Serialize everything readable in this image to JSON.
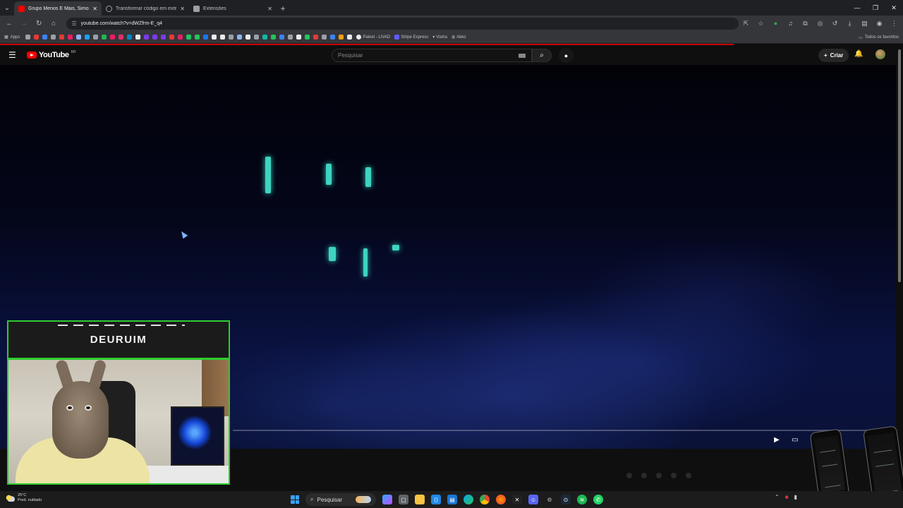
{
  "browser": {
    "tabs": [
      {
        "title": "Grupo Menos É Mais, Simo...",
        "favicon_color": "#ff0000",
        "active": true
      },
      {
        "title": "Transformar código em extensã...",
        "favicon_color": "#9aa0a6",
        "active": false
      },
      {
        "title": "Extensões",
        "favicon_color": "#9aa0a6",
        "active": false
      }
    ],
    "new_tab_symbol": "+",
    "url": "youtube.com/watch?v=dWZfrm-E_q4",
    "bookmarks": {
      "apps_label": "Apps",
      "items": [
        "Painel - LIVAD",
        "Stripe Express",
        "Vodra",
        "Akko"
      ],
      "all_bookmarks_label": "Todos os favoritos"
    }
  },
  "youtube": {
    "logo_text": "YouTube",
    "country_code": "BR",
    "search_placeholder": "Pesquisar",
    "create_label": "Criar",
    "accent_color": "#ff0000",
    "carousel_dots": 5
  },
  "overlay": {
    "streamer_name": "DEURUIM",
    "frame_color": "#2ecc2e"
  },
  "taskbar": {
    "weather_temp": "25°C",
    "weather_desc": "Pred. nublado",
    "search_label": "Pesquisar",
    "icons": [
      "windows-icon",
      "search-icon",
      "copilot-icon",
      "file-explorer-icon",
      "folder-icon",
      "vscode-icon",
      "store-icon",
      "edge-icon",
      "chrome-icon",
      "firefox-icon",
      "capcut-icon",
      "discord-icon",
      "settings-icon",
      "steam-icon",
      "spotify-icon",
      "whatsapp-icon"
    ]
  }
}
